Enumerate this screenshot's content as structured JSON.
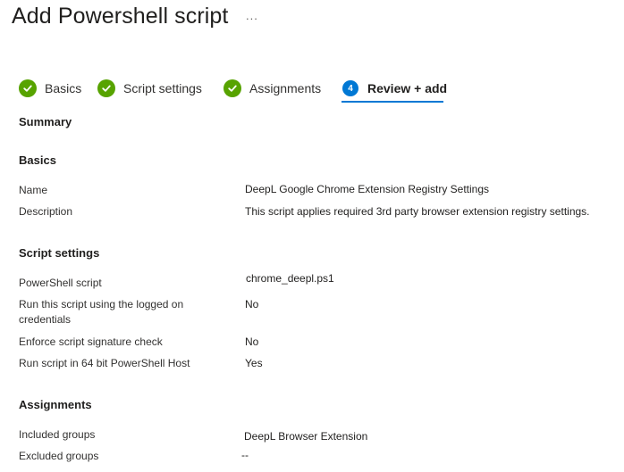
{
  "page": {
    "title": "Add Powershell script",
    "more_label": "..."
  },
  "wizard": {
    "steps": [
      {
        "label": "Basics",
        "state": "complete"
      },
      {
        "label": "Script settings",
        "state": "complete"
      },
      {
        "label": "Assignments",
        "state": "complete"
      },
      {
        "label": "Review + add",
        "state": "current",
        "number": "4"
      }
    ]
  },
  "summary": {
    "heading": "Summary",
    "basics": {
      "heading": "Basics",
      "name_label": "Name",
      "name_value": "DeepL Google Chrome Extension Registry Settings",
      "description_label": "Description",
      "description_value": "This script applies required 3rd party browser extension registry settings."
    },
    "script_settings": {
      "heading": "Script settings",
      "powershell_script_label": "PowerShell script",
      "powershell_script_value": "chrome_deepl.ps1",
      "run_logged_on_label_line1": "Run this script using the logged on",
      "run_logged_on_label_line2": "credentials",
      "run_logged_on_value": "No",
      "enforce_signature_label": "Enforce script signature check",
      "enforce_signature_value": "No",
      "run_64bit_label": "Run script in 64 bit PowerShell Host",
      "run_64bit_value": "Yes"
    },
    "assignments": {
      "heading": "Assignments",
      "included_label": "Included groups",
      "included_value": "DeepL Browser Extension",
      "excluded_label": "Excluded groups",
      "excluded_value": "--"
    }
  },
  "colors": {
    "complete": "#57a300",
    "accent": "#0078d4"
  },
  "icons": {
    "complete": "checkmark-circle-icon"
  }
}
